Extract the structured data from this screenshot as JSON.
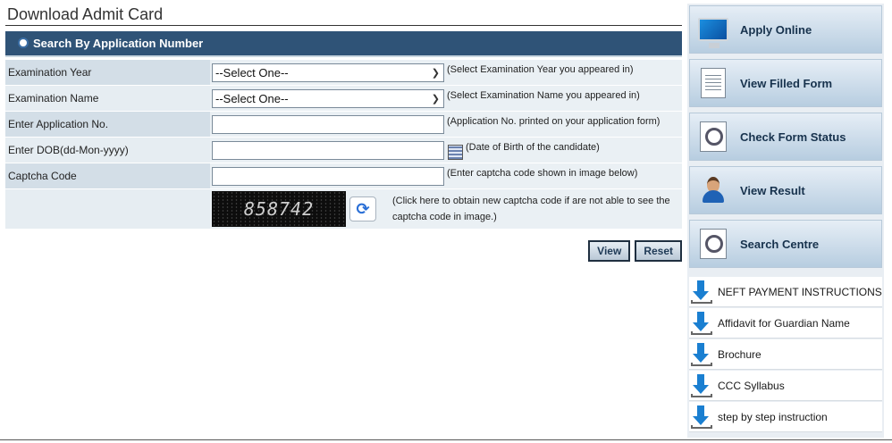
{
  "page": {
    "title": "Download Admit Card"
  },
  "panel": {
    "heading": "Search By Application Number"
  },
  "form": {
    "exam_year": {
      "label": "Examination Year",
      "value": "--Select One--",
      "hint": "(Select Examination Year you appeared in)"
    },
    "exam_name": {
      "label": "Examination Name",
      "value": "--Select One--",
      "hint": "(Select Examination Name you appeared in)"
    },
    "app_no": {
      "label": "Enter Application No.",
      "value": "",
      "hint": "(Application No. printed on your application form)"
    },
    "dob": {
      "label": "Enter DOB(dd-Mon-yyyy)",
      "value": "",
      "hint": "(Date of Birth of the candidate)"
    },
    "captcha": {
      "label": "Captcha Code",
      "value": "",
      "hint": "(Enter captcha code shown in image below)"
    },
    "captcha_image": {
      "code": "858742"
    },
    "captcha_hint": "(Click here to obtain new captcha code if are not able to see the captcha code in image.)"
  },
  "buttons": {
    "view": "View",
    "reset": "Reset"
  },
  "sidebar": {
    "tiles": [
      {
        "label": "Apply Online",
        "icon": "monitor-icon"
      },
      {
        "label": "View Filled Form",
        "icon": "form-document-icon"
      },
      {
        "label": "Check Form Status",
        "icon": "magnifier-document-icon"
      },
      {
        "label": "View Result",
        "icon": "user-search-icon"
      },
      {
        "label": "Search Centre",
        "icon": "magnifier-document-icon"
      }
    ],
    "links": [
      {
        "label": "NEFT PAYMENT INSTRUCTIONS"
      },
      {
        "label": "Affidavit for Guardian Name"
      },
      {
        "label": "Brochure"
      },
      {
        "label": "CCC Syllabus"
      },
      {
        "label": "step by step instruction"
      }
    ]
  }
}
